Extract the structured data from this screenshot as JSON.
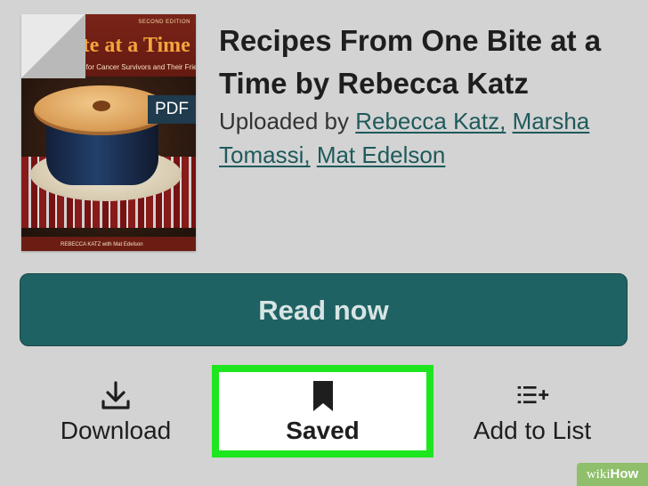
{
  "book": {
    "cover": {
      "edition": "SECOND EDITION",
      "title": "ite at a Time",
      "subtitle": "es for Cancer Survivors and Their Friends",
      "author": "REBECCA KATZ with Mat Edelson",
      "format_badge": "PDF",
      "colors": {
        "background": "#6b1d14",
        "title": "#f4a53c",
        "badge": "#1f3b4d"
      }
    },
    "title": "Recipes From One Bite at a Time by Rebecca Katz",
    "uploaded_prefix": "Uploaded by",
    "uploaders": [
      {
        "name": "Rebecca Katz,"
      },
      {
        "name": "Marsha Tomassi,"
      },
      {
        "name": "Mat Edelson"
      }
    ]
  },
  "primary_action": {
    "label": "Read now",
    "color": "#1f6263"
  },
  "actions": {
    "download": {
      "label": "Download",
      "icon": "download-icon"
    },
    "saved": {
      "label": "Saved",
      "icon": "bookmark-icon",
      "highlight_color": "#1ee61e"
    },
    "add_to_list": {
      "label": "Add to List",
      "icon": "add-to-list-icon"
    }
  },
  "watermark": {
    "prefix": "wiki",
    "suffix": "How"
  }
}
